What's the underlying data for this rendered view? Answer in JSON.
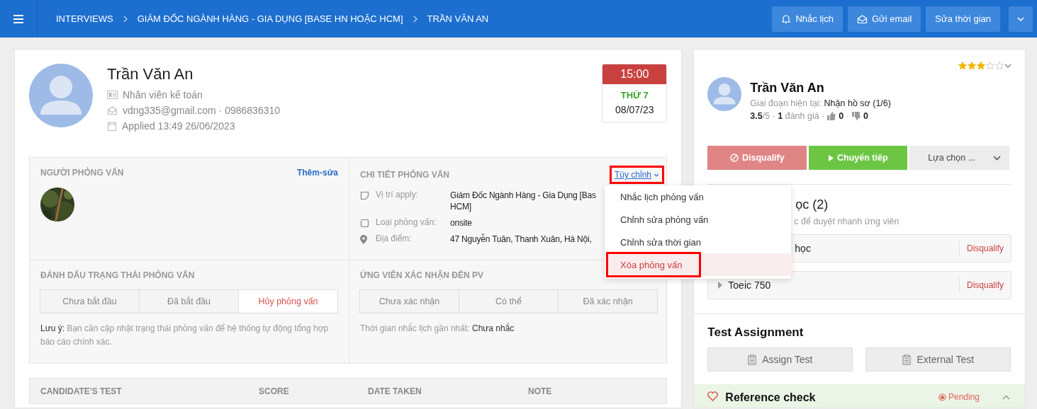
{
  "header": {
    "breadcrumbs": [
      "INTERVIEWS",
      "GIÁM ĐỐC NGÀNH HÀNG - GIA DỤNG [BASE HN HOẶC HCM]",
      "TRẦN VĂN AN"
    ],
    "buttons": [
      "Nhắc lịch",
      "Gửi email",
      "Sửa thời gian"
    ]
  },
  "candidate": {
    "name": "Trần Văn An",
    "position": "Nhân viên kế toán",
    "contact": "vdng335@gmail.com · 0986836310",
    "applied": "Applied 13:49 26/06/2023"
  },
  "schedule": {
    "time": "15:00",
    "weekday": "THỨ 7",
    "date": "08/07/23"
  },
  "interviewers": {
    "title": "NGƯỜI PHỎNG VẤN",
    "action": "Thêm-sửa"
  },
  "details": {
    "title": "CHI TIẾT PHỎNG VẤN",
    "action": {
      "label": "Tùy chỉnh",
      "highlighted": true
    },
    "fields": [
      {
        "label": "Vị trí apply:",
        "value_lines": [
          "Giám Đốc Ngành Hàng - Gia Dụng [Bas",
          "HCM]"
        ]
      },
      {
        "label": "Loại phỏng vấn:",
        "value_lines": [
          "onsite"
        ]
      },
      {
        "label": "Địa điểm:",
        "value_lines": [
          "47 Nguyễn Tuân, Thanh Xuân, Hà Nội,"
        ]
      }
    ]
  },
  "status": {
    "title": "ĐÁNH DẤU TRẠNG THÁI PHỎNG VẤN",
    "options": [
      {
        "label": "Chưa bắt đầu",
        "selected": false
      },
      {
        "label": "Đã bắt đầu",
        "selected": false
      },
      {
        "label": "Hủy phỏng vấn",
        "selected": true
      }
    ],
    "note_label": "Lưu ý:",
    "note": "Bạn cần cập nhật trạng thái phỏng vấn để hệ thống tự động tổng hợp báo cáo chính xác."
  },
  "confirmation": {
    "title": "ỨNG VIÊN XÁC NHẬN ĐẾN PV",
    "options": [
      {
        "label": "Chưa xác nhận",
        "selected": false
      },
      {
        "label": "Có thể",
        "selected": false
      },
      {
        "label": "Đã xác nhận",
        "selected": false
      }
    ],
    "reminder_label": "Thời gian nhắc lịch gần nhất:",
    "reminder_value": "Chưa nhắc"
  },
  "test_table": {
    "columns": [
      "CANDIDATE'S TEST",
      "SCORE",
      "DATE TAKEN",
      "NOTE"
    ]
  },
  "menu": {
    "items": [
      {
        "label": "Nhắc lịch phỏng vấn",
        "kind": "normal",
        "highlighted": false
      },
      {
        "label": "Chỉnh sửa phỏng vấn",
        "kind": "normal",
        "highlighted": false
      },
      {
        "label": "Chỉnh sửa thời gian",
        "kind": "normal",
        "highlighted": false
      },
      {
        "label": "Xóa phỏng vấn",
        "kind": "danger",
        "highlighted": true
      }
    ]
  },
  "profile": {
    "name": "Trần Văn An",
    "stage_label": "Giai đoạn hiện tại:",
    "stage": "Nhận hồ sơ (1/6)",
    "stars": 3,
    "rating_text": "**3.5**/5 · **1** đánh giá ·",
    "likes": "**0** ·",
    "dislikes": "0"
  },
  "actions": [
    {
      "label": "Disqualify",
      "kind": "disqualify"
    },
    {
      "label": "Chuyển tiếp",
      "kind": "forward"
    },
    {
      "label": "Lựa chọn ...",
      "kind": "more"
    }
  ],
  "screening": {
    "title": "ọc (2)",
    "subtitle": "c để duyệt nhanh ứng viên",
    "criteria": [
      {
        "label": "học",
        "kind": "covered",
        "action": "Disqualify"
      },
      {
        "label": "Toeic 750",
        "kind": "row",
        "action": "Disqualify"
      }
    ]
  },
  "test_assignment": {
    "title": "Test Assignment",
    "buttons": [
      "Assign Test",
      "External Test"
    ]
  },
  "reference": {
    "title": "Reference check",
    "status": "Pending"
  }
}
